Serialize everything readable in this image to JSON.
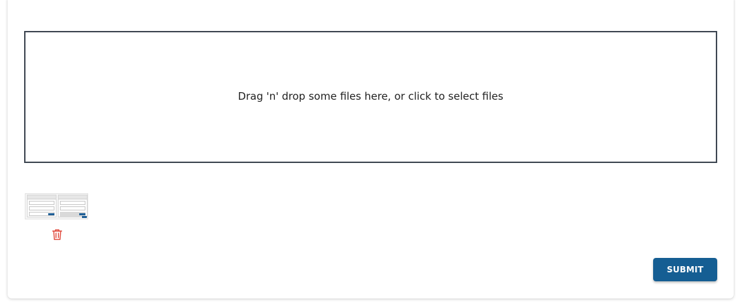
{
  "uploader": {
    "dropzone_text": "Drag 'n' drop some files here, or click to select files",
    "border_color": "#3f4752"
  },
  "uploaded_files": [
    {
      "kind": "image-thumbnail",
      "delete_icon": "trash-icon",
      "delete_icon_color": "#e0483b"
    }
  ],
  "form": {
    "submit_label": "SUBMIT",
    "submit_color": "#155e93"
  }
}
